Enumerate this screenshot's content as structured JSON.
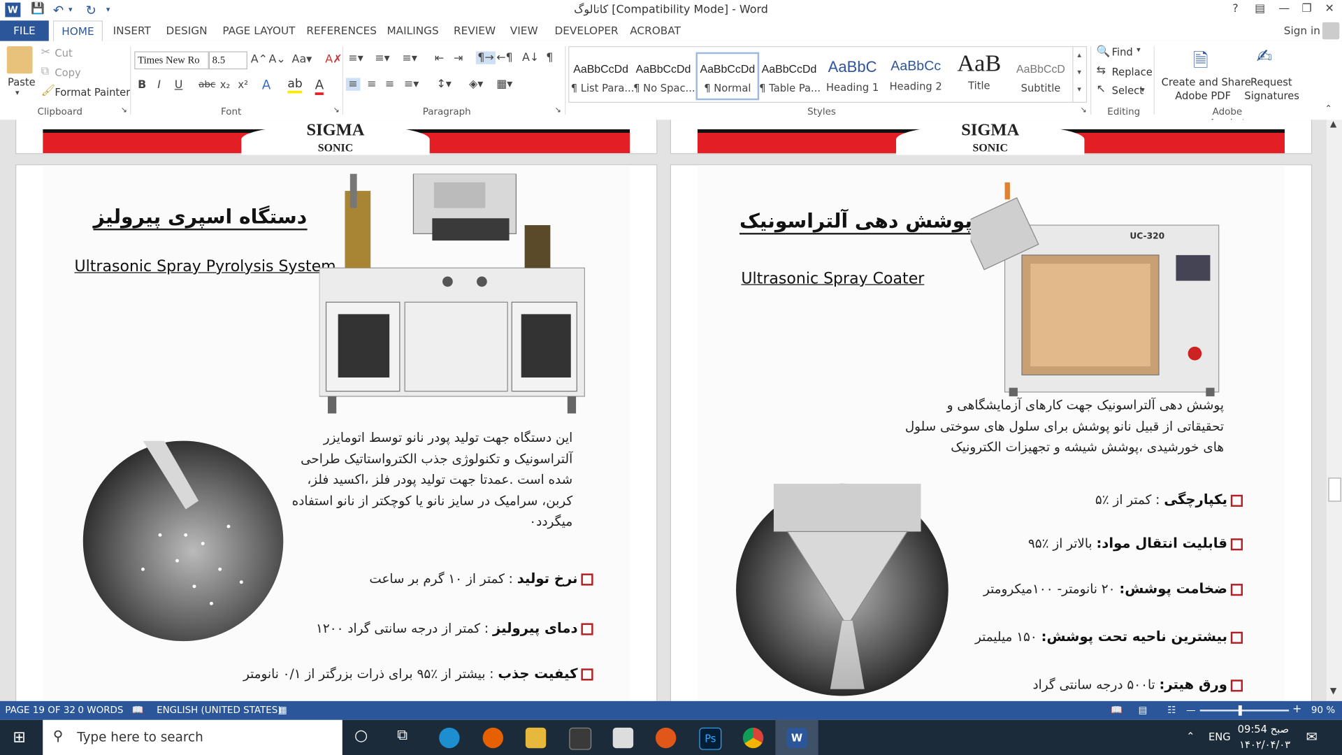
{
  "window": {
    "title": "کاتالوگ [Compatibility Mode] - Word",
    "help": "?",
    "sign_in": "Sign in"
  },
  "ribbon_tabs": [
    "FILE",
    "HOME",
    "INSERT",
    "DESIGN",
    "PAGE LAYOUT",
    "REFERENCES",
    "MAILINGS",
    "REVIEW",
    "VIEW",
    "DEVELOPER",
    "ACROBAT"
  ],
  "clipboard": {
    "paste": "Paste",
    "cut": "Cut",
    "copy": "Copy",
    "format_painter": "Format Painter",
    "label": "Clipboard"
  },
  "font": {
    "name": "Times New Ro",
    "size": "8.5",
    "label": "Font"
  },
  "paragraph": {
    "label": "Paragraph"
  },
  "styles": {
    "label": "Styles",
    "items": [
      {
        "preview": "AaBbCcDd",
        "name": "¶ List Para..."
      },
      {
        "preview": "AaBbCcDd",
        "name": "¶ No Spac..."
      },
      {
        "preview": "AaBbCcDd",
        "name": "¶ Normal"
      },
      {
        "preview": "AaBbCcDd",
        "name": "¶ Table Pa..."
      },
      {
        "preview": "AaBbC",
        "name": "Heading 1"
      },
      {
        "preview": "AaBbCc",
        "name": "Heading 2"
      },
      {
        "preview": "AaB",
        "name": "Title"
      },
      {
        "preview": "AaBbCcD",
        "name": "Subtitle"
      }
    ]
  },
  "editing": {
    "find": "Find",
    "replace": "Replace",
    "select": "Select",
    "label": "Editing"
  },
  "acrobat": {
    "create_share": "Create and Share",
    "adobe_pdf": "Adobe PDF",
    "request": "Request",
    "signatures": "Signatures",
    "label": "Adobe Acrobat"
  },
  "header_logo": {
    "brand": "SIGMA",
    "sub": "SONIC"
  },
  "left_page": {
    "title_fa": "دستگاه اسپری پیرولیز",
    "title_en": "Ultrasonic Spray Pyrolysis System",
    "description": "این دستگاه جهت تولید پودر نانو توسط اتومایزر آلتراسونیک و تکنولوژی جذب الکترواستاتیک طراحی شده است .عمدتا جهت تولید پودر فلز ،اکسید فلز، کربن، سرامیک در سایز نانو یا کوچکتر از نانو استفاده میگردد٠",
    "specs": [
      {
        "label": "نرخ تولید",
        "value": ": کمتر از ۱۰ گرم بر ساعت"
      },
      {
        "label": "دمای پیرولیز",
        "value": ": کمتر از درجه سانتی گراد ۱۲۰۰"
      },
      {
        "label": "کیفیت جذب",
        "value": ": بیشتر از ٪۹۵ برای ذرات بزرگتر از ۰/۱ نانومتر"
      }
    ]
  },
  "right_page": {
    "title_fa": "پوشش دهی آلتراسونیک",
    "title_en": "Ultrasonic Spray Coater",
    "machine_label": "UC-320",
    "description": "پوشش دهی آلتراسونیک جهت کارهای آزمایشگاهی و تحقیقاتی از قبیل نانو پوشش برای سلول های سوختی سلول های خورشیدی ،پوشش شیشه و تجهیزات الکترونیک",
    "specs": [
      {
        "label": "یکپارچگی",
        "value": ": کمتر از ٪۵"
      },
      {
        "label": "قابلیت انتقال مواد:",
        "value": "بالاتر از ٪۹۵"
      },
      {
        "label": "ضخامت پوشش:",
        "value": "۲۰ نانومتر- ۱۰۰میکرومتر"
      },
      {
        "label": "بیشترین ناحیه تحت پوشش:",
        "value": "۱۵۰ میلیمتر"
      },
      {
        "label": "ورق هیتر:",
        "value": "تا۵۰۰ درجه سانتی گراد"
      }
    ]
  },
  "status": {
    "page": "PAGE 19 OF 32",
    "words": "0 WORDS",
    "language": "ENGLISH (UNITED STATES)",
    "zoom": "90 %"
  },
  "taskbar": {
    "search_placeholder": "Type here to search",
    "lang": "ENG",
    "time": "09:54 صبح",
    "date": "۱۴۰۲/۰۴/۰۳"
  },
  "colors": {
    "word_blue": "#2b579a",
    "brand_red": "#e31e24",
    "checkbox_red": "#b21f24"
  }
}
